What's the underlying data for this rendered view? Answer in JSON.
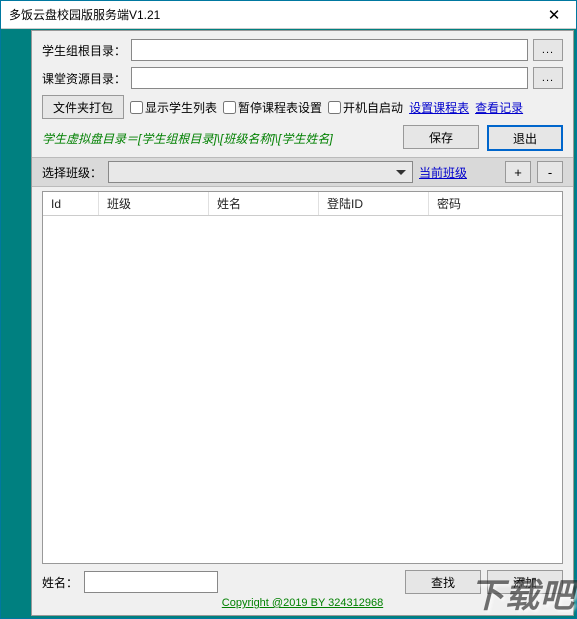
{
  "window": {
    "title": "多饭云盘校园版服务端V1.21"
  },
  "paths": {
    "student_root_label": "学生组根目录：",
    "student_root_value": "",
    "class_res_label": "课堂资源目录：",
    "class_res_value": "",
    "browse": "..."
  },
  "toolbar": {
    "pack_folder": "文件夹打包",
    "cb_show_students": "显示学生列表",
    "cb_pause_schedule": "暂停课程表设置",
    "cb_auto_start": "开机自启动",
    "link_set_schedule": "设置课程表",
    "link_view_log": "查看记录"
  },
  "hint": {
    "text": "学生虚拟盘目录＝[学生组根目录]\\[班级名称]\\[学生姓名]",
    "save": "保存",
    "exit": "退出"
  },
  "selector": {
    "label": "选择班级：",
    "current_class": "当前班级",
    "plus": "+",
    "minus": "-"
  },
  "table": {
    "cols": {
      "id": "Id",
      "class": "班级",
      "name": "姓名",
      "login": "登陆ID",
      "pwd": "密码"
    }
  },
  "footer": {
    "name_label": "姓名：",
    "name_value": "",
    "find": "查找",
    "add": "添加"
  },
  "copyright": "Copyright @2019 BY 324312968",
  "watermark": "下载吧"
}
